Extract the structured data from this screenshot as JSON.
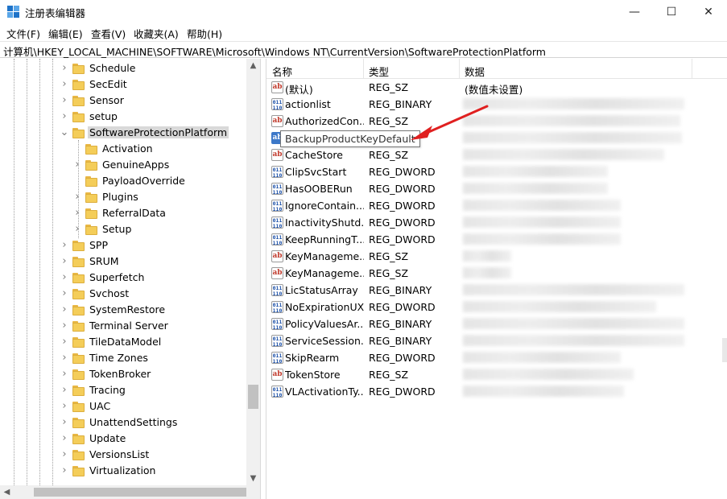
{
  "window": {
    "title": "注册表编辑器",
    "minimize_glyph": "—",
    "maximize_glyph": "☐",
    "close_glyph": "✕"
  },
  "menu": [
    "文件(F)",
    "编辑(E)",
    "查看(V)",
    "收藏夹(A)",
    "帮助(H)"
  ],
  "address": "计算机\\HKEY_LOCAL_MACHINE\\SOFTWARE\\Microsoft\\Windows NT\\CurrentVersion\\SoftwareProtectionPlatform",
  "tree": {
    "items": [
      {
        "label": "Schedule",
        "expand": "›",
        "level": 1
      },
      {
        "label": "SecEdit",
        "expand": "›",
        "level": 1
      },
      {
        "label": "Sensor",
        "expand": "›",
        "level": 1
      },
      {
        "label": "setup",
        "expand": "›",
        "level": 1
      },
      {
        "label": "SoftwareProtectionPlatform",
        "expand": "⌄",
        "level": 1,
        "selected": true
      },
      {
        "label": "Activation",
        "expand": "",
        "level": 2
      },
      {
        "label": "GenuineApps",
        "expand": "›",
        "level": 2
      },
      {
        "label": "PayloadOverride",
        "expand": "",
        "level": 2
      },
      {
        "label": "Plugins",
        "expand": "›",
        "level": 2
      },
      {
        "label": "ReferralData",
        "expand": "›",
        "level": 2
      },
      {
        "label": "Setup",
        "expand": "›",
        "level": 2
      },
      {
        "label": "SPP",
        "expand": "›",
        "level": 1
      },
      {
        "label": "SRUM",
        "expand": "›",
        "level": 1
      },
      {
        "label": "Superfetch",
        "expand": "›",
        "level": 1
      },
      {
        "label": "Svchost",
        "expand": "›",
        "level": 1
      },
      {
        "label": "SystemRestore",
        "expand": "›",
        "level": 1
      },
      {
        "label": "Terminal Server",
        "expand": "›",
        "level": 1
      },
      {
        "label": "TileDataModel",
        "expand": "›",
        "level": 1
      },
      {
        "label": "Time Zones",
        "expand": "›",
        "level": 1
      },
      {
        "label": "TokenBroker",
        "expand": "›",
        "level": 1
      },
      {
        "label": "Tracing",
        "expand": "›",
        "level": 1
      },
      {
        "label": "UAC",
        "expand": "›",
        "level": 1
      },
      {
        "label": "UnattendSettings",
        "expand": "›",
        "level": 1
      },
      {
        "label": "Update",
        "expand": "›",
        "level": 1
      },
      {
        "label": "VersionsList",
        "expand": "›",
        "level": 1
      },
      {
        "label": "Virtualization",
        "expand": "›",
        "level": 1
      }
    ]
  },
  "list": {
    "columns": [
      "名称",
      "类型",
      "数据"
    ],
    "rows": [
      {
        "name": "(默认)",
        "type": "REG_SZ",
        "data": "(数值未设置)",
        "icon": "sz"
      },
      {
        "name": "actionlist",
        "type": "REG_BINARY",
        "data": "",
        "icon": "bin"
      },
      {
        "name": "AuthorizedCon...",
        "type": "REG_SZ",
        "data": "",
        "icon": "sz"
      },
      {
        "name": "BackupProductKeyDefault",
        "type": "",
        "data": "",
        "icon": "sz",
        "selected": true
      },
      {
        "name": "CacheStore",
        "type": "REG_SZ",
        "data": "",
        "icon": "sz"
      },
      {
        "name": "ClipSvcStart",
        "type": "REG_DWORD",
        "data": "",
        "icon": "bin"
      },
      {
        "name": "HasOOBERun",
        "type": "REG_DWORD",
        "data": "",
        "icon": "bin"
      },
      {
        "name": "IgnoreContain...",
        "type": "REG_DWORD",
        "data": "",
        "icon": "bin"
      },
      {
        "name": "InactivityShutd...",
        "type": "REG_DWORD",
        "data": "",
        "icon": "bin"
      },
      {
        "name": "KeepRunningT...",
        "type": "REG_DWORD",
        "data": "",
        "icon": "bin"
      },
      {
        "name": "KeyManageme...",
        "type": "REG_SZ",
        "data": "",
        "icon": "sz"
      },
      {
        "name": "KeyManageme...",
        "type": "REG_SZ",
        "data": "",
        "icon": "sz"
      },
      {
        "name": "LicStatusArray",
        "type": "REG_BINARY",
        "data": "",
        "icon": "bin"
      },
      {
        "name": "NoExpirationUX",
        "type": "REG_DWORD",
        "data": "",
        "icon": "bin"
      },
      {
        "name": "PolicyValuesAr...",
        "type": "REG_BINARY",
        "data": "",
        "icon": "bin"
      },
      {
        "name": "ServiceSession...",
        "type": "REG_BINARY",
        "data": "",
        "icon": "bin"
      },
      {
        "name": "SkipRearm",
        "type": "REG_DWORD",
        "data": "",
        "icon": "bin"
      },
      {
        "name": "TokenStore",
        "type": "REG_SZ",
        "data": "",
        "icon": "sz"
      },
      {
        "name": "VLActivationTy...",
        "type": "REG_DWORD",
        "data": "",
        "icon": "bin"
      }
    ]
  },
  "tooltip": "BackupProductKeyDefault",
  "colors": {
    "annotation_arrow": "#e02020",
    "folder": "#f4cd59",
    "selection": "#d9d9d9",
    "string_icon": "#c0392b",
    "binary_icon": "#1a4fa8"
  },
  "icons": {
    "app": "registry-editor-icon",
    "string_value": "string-value-icon",
    "binary_value": "binary-value-icon",
    "folder": "folder-icon"
  }
}
